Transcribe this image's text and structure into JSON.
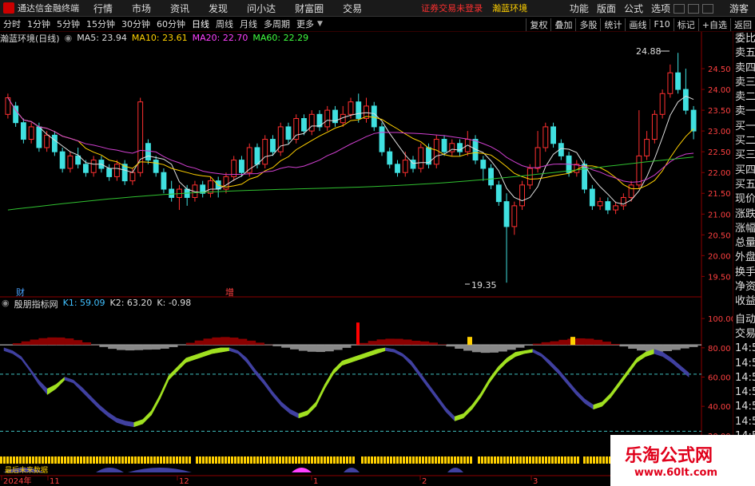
{
  "menubar": {
    "app_title": "通达信金融终端",
    "items": [
      "行情",
      "市场",
      "资讯",
      "发现",
      "问小达",
      "财富圈",
      "交易"
    ],
    "notice": "证券交易未登录",
    "notice2": "瀚蓝环境",
    "right_items": [
      "功能",
      "版面",
      "公式",
      "选项"
    ],
    "guest": "游客"
  },
  "periodbar": {
    "items": [
      "分时",
      "1分钟",
      "5分钟",
      "15分钟",
      "30分钟",
      "60分钟",
      "日线",
      "周线",
      "月线",
      "多周期",
      "更多"
    ],
    "active": "日线",
    "right_items": [
      "复权",
      "叠加",
      "多股",
      "统计",
      "画线",
      "F10",
      "标记",
      "+自选",
      "返回"
    ]
  },
  "legend": {
    "stock": "瀚蓝环境(日线)",
    "ma5": "MA5: 23.94",
    "ma10": "MA10: 23.61",
    "ma20": "MA20: 22.70",
    "ma60": "MA60: 22.29"
  },
  "main_annotations": {
    "high": "24.88",
    "low": "19.35",
    "cai": "财",
    "zeng": "增"
  },
  "indicator_legend": {
    "name": "殷朋指标网",
    "k1": "K1: 59.09",
    "k2": "K2: 63.20",
    "k": "K: -0.98"
  },
  "date_labels": [
    "2024年",
    "11",
    "12",
    "1",
    "2",
    "3"
  ],
  "side_panel": [
    "委比",
    "卖五",
    "卖四",
    "卖三",
    "卖二",
    "卖一",
    "买一",
    "买二",
    "买三",
    "买四",
    "买五",
    "现价",
    "涨跌",
    "涨幅",
    "总量",
    "外盘",
    "换手",
    "净资",
    "收益",
    "自动",
    "交易",
    "14:56",
    "14:56",
    "14:56",
    "14:56",
    "14:56",
    "14:56",
    "14:56"
  ],
  "watermark": {
    "line1": "乐淘公式网",
    "line2": "www.60lt.com"
  },
  "bottom_note": "最后未来数据",
  "chart_data": [
    {
      "type": "candlestick",
      "title": "瀚蓝环境(日线)",
      "yticks": [
        24.5,
        24.0,
        23.5,
        23.0,
        22.5,
        22.0,
        21.5,
        21.0,
        20.5,
        20.0,
        19.5
      ],
      "ylim": [
        19.2,
        25.0
      ],
      "candles": [
        [
          23.4,
          23.8,
          23.9,
          23.3
        ],
        [
          23.6,
          23.2,
          23.7,
          23.1
        ],
        [
          23.2,
          22.8,
          23.3,
          22.7
        ],
        [
          22.8,
          23.1,
          23.2,
          22.7
        ],
        [
          23.1,
          22.6,
          23.2,
          22.5
        ],
        [
          22.6,
          22.9,
          23.0,
          22.5
        ],
        [
          22.9,
          22.5,
          23.0,
          22.4
        ],
        [
          22.5,
          22.1,
          22.6,
          22.0
        ],
        [
          22.1,
          22.4,
          22.5,
          22.0
        ],
        [
          22.4,
          22.2,
          22.6,
          22.1
        ],
        [
          22.2,
          22.0,
          22.3,
          21.9
        ],
        [
          22.0,
          22.3,
          22.4,
          21.9
        ],
        [
          22.3,
          22.1,
          22.4,
          22.0
        ],
        [
          22.1,
          21.9,
          22.2,
          21.8
        ],
        [
          21.9,
          22.2,
          22.3,
          21.8
        ],
        [
          22.2,
          21.8,
          22.3,
          21.7
        ],
        [
          21.8,
          22.0,
          22.1,
          21.7
        ],
        [
          22.0,
          23.7,
          23.8,
          21.9
        ],
        [
          22.7,
          22.3,
          22.8,
          22.2
        ],
        [
          22.3,
          22.0,
          22.4,
          21.9
        ],
        [
          22.0,
          21.6,
          22.1,
          21.5
        ],
        [
          21.6,
          21.4,
          21.8,
          21.3
        ],
        [
          21.4,
          21.6,
          21.7,
          21.1
        ],
        [
          21.6,
          21.4,
          21.7,
          21.2
        ],
        [
          21.4,
          21.7,
          21.8,
          21.3
        ],
        [
          21.7,
          21.5,
          21.8,
          21.4
        ],
        [
          21.5,
          21.8,
          21.9,
          21.4
        ],
        [
          21.8,
          21.6,
          21.9,
          21.4
        ],
        [
          21.6,
          21.9,
          22.0,
          21.5
        ],
        [
          21.9,
          22.3,
          22.4,
          21.8
        ],
        [
          22.3,
          22.0,
          22.4,
          21.9
        ],
        [
          22.0,
          22.6,
          22.7,
          21.9
        ],
        [
          22.6,
          22.2,
          22.7,
          22.1
        ],
        [
          22.2,
          22.8,
          22.9,
          22.1
        ],
        [
          22.8,
          22.5,
          22.9,
          22.4
        ],
        [
          22.5,
          23.1,
          23.2,
          22.4
        ],
        [
          23.1,
          22.8,
          23.2,
          22.7
        ],
        [
          22.8,
          23.3,
          23.4,
          22.7
        ],
        [
          23.3,
          23.0,
          23.4,
          22.9
        ],
        [
          23.0,
          23.4,
          23.5,
          22.9
        ],
        [
          23.4,
          23.1,
          23.5,
          23.0
        ],
        [
          23.1,
          23.5,
          23.6,
          23.0
        ],
        [
          23.5,
          23.2,
          23.6,
          23.1
        ],
        [
          23.2,
          23.4,
          23.6,
          23.1
        ],
        [
          23.4,
          23.7,
          23.8,
          23.3
        ],
        [
          23.7,
          23.3,
          23.9,
          23.2
        ],
        [
          23.3,
          23.6,
          23.8,
          23.2
        ],
        [
          23.6,
          23.1,
          23.7,
          23.0
        ],
        [
          23.1,
          22.5,
          23.2,
          22.4
        ],
        [
          22.5,
          22.2,
          22.6,
          22.1
        ],
        [
          22.2,
          22.0,
          22.3,
          21.9
        ],
        [
          22.0,
          22.3,
          22.5,
          21.9
        ],
        [
          22.3,
          22.1,
          22.4,
          22.0
        ],
        [
          22.1,
          22.6,
          22.7,
          22.0
        ],
        [
          22.6,
          22.2,
          22.7,
          22.1
        ],
        [
          22.2,
          22.8,
          22.9,
          22.1
        ],
        [
          22.8,
          22.5,
          22.9,
          22.4
        ],
        [
          22.5,
          22.7,
          22.8,
          22.4
        ],
        [
          22.7,
          22.5,
          22.8,
          22.4
        ],
        [
          22.5,
          22.8,
          23.0,
          22.4
        ],
        [
          22.8,
          22.3,
          22.9,
          22.2
        ],
        [
          22.3,
          22.1,
          22.4,
          21.8
        ],
        [
          22.1,
          21.7,
          22.2,
          21.6
        ],
        [
          21.7,
          21.3,
          21.8,
          21.2
        ],
        [
          21.3,
          20.7,
          21.5,
          19.35
        ],
        [
          20.7,
          21.2,
          21.3,
          20.5
        ],
        [
          21.2,
          21.7,
          21.8,
          21.1
        ],
        [
          21.7,
          22.1,
          22.2,
          21.6
        ],
        [
          22.1,
          22.6,
          23.0,
          22.0
        ],
        [
          22.6,
          23.1,
          23.2,
          22.5
        ],
        [
          23.1,
          22.7,
          23.2,
          22.6
        ],
        [
          22.7,
          22.4,
          22.8,
          22.3
        ],
        [
          22.4,
          22.0,
          22.5,
          21.9
        ],
        [
          22.0,
          22.2,
          22.3,
          21.9
        ],
        [
          22.2,
          21.6,
          22.3,
          21.5
        ],
        [
          21.6,
          21.2,
          21.7,
          21.1
        ],
        [
          21.2,
          21.3,
          21.4,
          21.1
        ],
        [
          21.3,
          21.1,
          21.4,
          21.0
        ],
        [
          21.1,
          21.2,
          21.3,
          21.0
        ],
        [
          21.2,
          21.4,
          21.5,
          21.1
        ],
        [
          21.4,
          21.7,
          21.8,
          21.3
        ],
        [
          21.7,
          22.4,
          23.5,
          21.6
        ],
        [
          22.4,
          22.8,
          23.0,
          22.3
        ],
        [
          22.8,
          23.4,
          23.5,
          22.7
        ],
        [
          23.4,
          23.9,
          24.0,
          23.3
        ],
        [
          23.9,
          24.4,
          24.6,
          23.8
        ],
        [
          24.4,
          24.0,
          24.88,
          23.9
        ],
        [
          24.0,
          23.5,
          24.5,
          23.4
        ],
        [
          23.5,
          23.0,
          23.6,
          22.8
        ]
      ]
    },
    {
      "type": "area",
      "title": "殷朋指标网",
      "yticks": [
        100.0,
        80.0,
        60.0,
        40.0,
        20.0
      ],
      "ylim": [
        15,
        105
      ],
      "series": [
        {
          "name": "K1",
          "values": [
            78,
            76,
            72,
            64,
            55,
            48,
            52,
            58,
            56,
            50,
            44,
            38,
            33,
            29,
            27,
            26,
            28,
            34,
            45,
            58,
            64,
            70,
            72,
            74,
            76,
            77,
            78,
            76,
            70,
            62,
            55,
            47,
            40,
            35,
            32,
            34,
            40,
            52,
            62,
            68,
            70,
            72,
            74,
            76,
            78,
            77,
            74,
            68,
            60,
            52,
            44,
            36,
            30,
            32,
            38,
            46,
            56,
            64,
            70,
            74,
            76,
            77,
            74,
            68,
            62,
            55,
            48,
            42,
            38,
            40,
            46,
            54,
            62,
            70,
            74,
            76,
            74,
            70,
            65,
            60
          ]
        },
        {
          "name": "K2",
          "values": [
            80,
            78,
            74,
            66,
            58,
            52,
            55,
            60,
            58,
            53,
            47,
            41,
            36,
            32,
            30,
            29,
            31,
            37,
            48,
            61,
            67,
            73,
            75,
            77,
            79,
            80,
            80,
            78,
            73,
            65,
            58,
            50,
            43,
            38,
            35,
            37,
            43,
            55,
            65,
            71,
            73,
            75,
            77,
            79,
            80,
            79,
            76,
            71,
            63,
            55,
            47,
            39,
            33,
            35,
            41,
            49,
            59,
            67,
            73,
            77,
            78,
            79,
            76,
            71,
            65,
            58,
            51,
            45,
            41,
            43,
            49,
            57,
            65,
            73,
            77,
            79,
            77,
            73,
            68,
            63
          ]
        }
      ]
    }
  ]
}
